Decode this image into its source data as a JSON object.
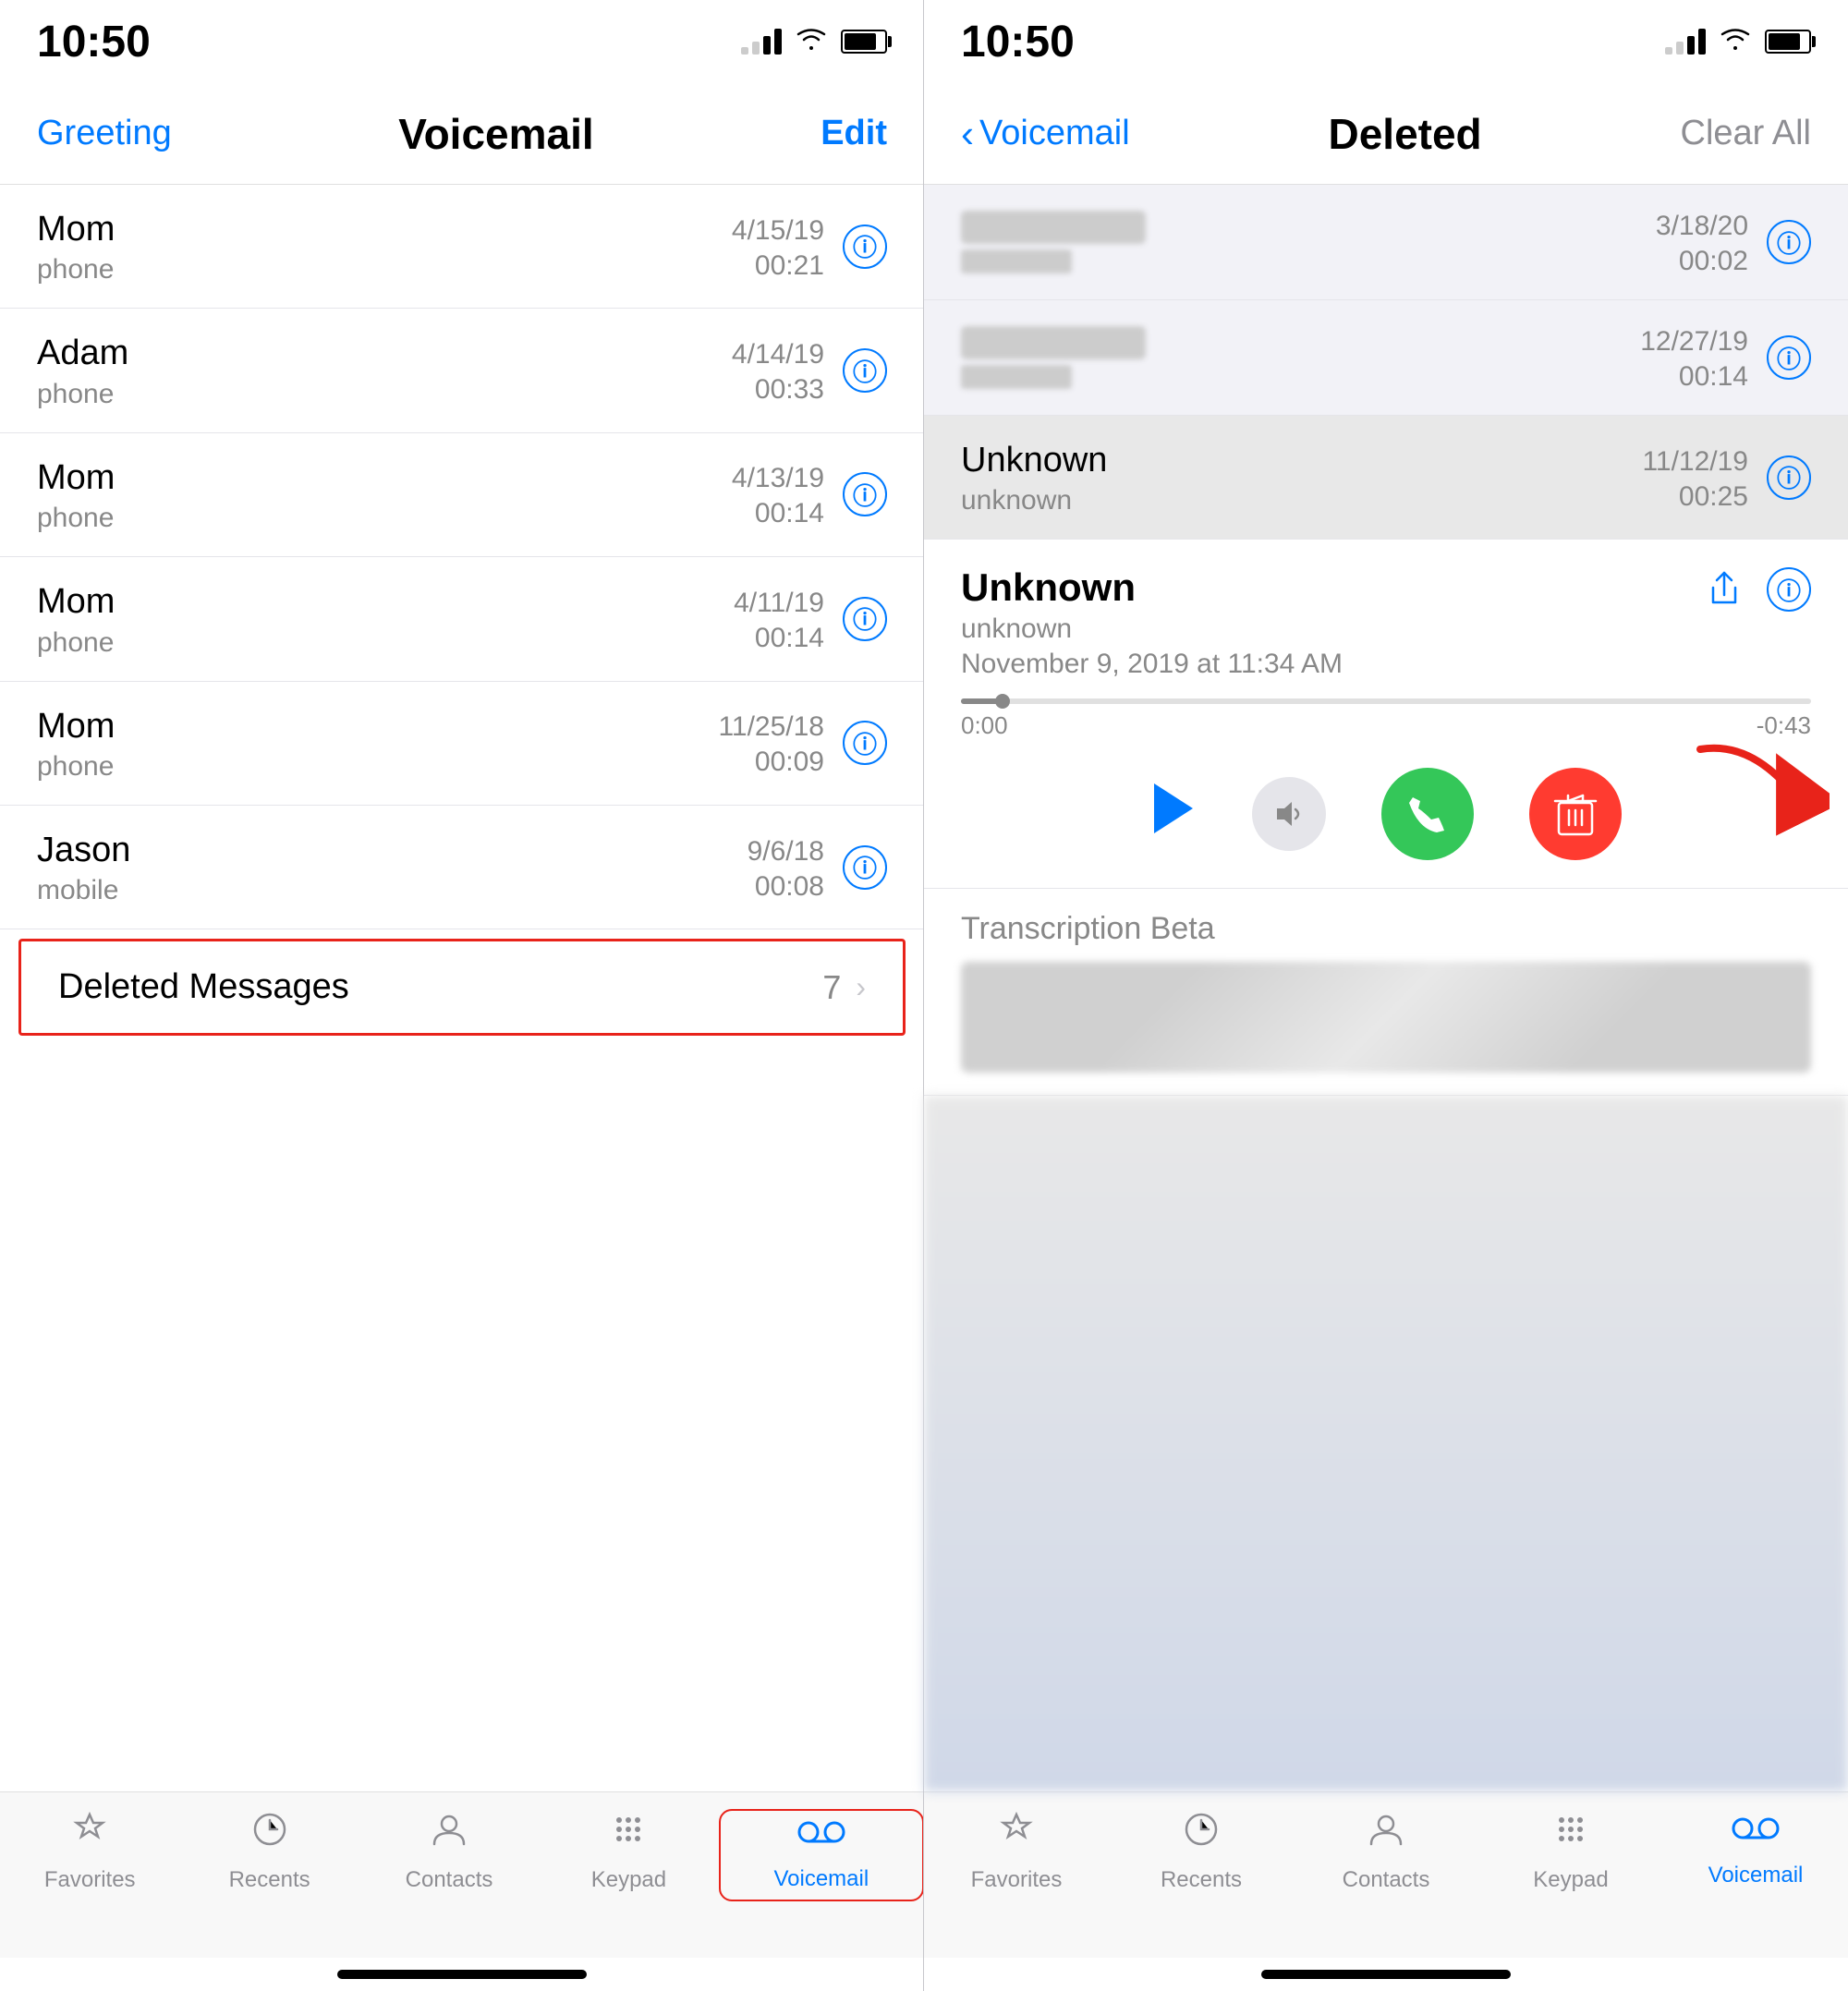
{
  "left": {
    "statusBar": {
      "time": "10:50"
    },
    "navBar": {
      "greetingLabel": "Greeting",
      "title": "Voicemail",
      "editLabel": "Edit"
    },
    "voicemails": [
      {
        "name": "Mom",
        "type": "phone",
        "date": "4/15/19",
        "duration": "00:21"
      },
      {
        "name": "Adam",
        "type": "phone",
        "date": "4/14/19",
        "duration": "00:33"
      },
      {
        "name": "Mom",
        "type": "phone",
        "date": "4/13/19",
        "duration": "00:14"
      },
      {
        "name": "Mom",
        "type": "phone",
        "date": "4/11/19",
        "duration": "00:14"
      },
      {
        "name": "Mom",
        "type": "phone",
        "date": "11/25/18",
        "duration": "00:09"
      },
      {
        "name": "Jason",
        "type": "mobile",
        "date": "9/6/18",
        "duration": "00:08"
      }
    ],
    "deletedMessages": {
      "label": "Deleted Messages",
      "count": "7"
    },
    "tabBar": {
      "items": [
        {
          "id": "favorites",
          "label": "Favorites",
          "icon": "★"
        },
        {
          "id": "recents",
          "label": "Recents",
          "icon": "⏱"
        },
        {
          "id": "contacts",
          "label": "Contacts",
          "icon": "👤"
        },
        {
          "id": "keypad",
          "label": "Keypad",
          "icon": "⠿"
        },
        {
          "id": "voicemail",
          "label": "Voicemail",
          "icon": "oo",
          "active": true
        }
      ]
    }
  },
  "right": {
    "statusBar": {
      "time": "10:50"
    },
    "navBar": {
      "backLabel": "Voicemail",
      "title": "Deleted",
      "clearAllLabel": "Clear All"
    },
    "deletedItems": [
      {
        "date": "3/18/20",
        "duration": "00:02",
        "blurred": true
      },
      {
        "date": "12/27/19",
        "duration": "00:14",
        "blurred": true
      },
      {
        "name": "Unknown",
        "type": "unknown",
        "date": "11/12/19",
        "duration": "00:25",
        "blurred": false
      }
    ],
    "expandedItem": {
      "name": "Unknown",
      "type": "unknown",
      "date": "November 9, 2019 at 11:34 AM",
      "progressStart": "0:00",
      "progressEnd": "-0:43"
    },
    "transcription": {
      "label": "Transcription Beta"
    },
    "tabBar": {
      "items": [
        {
          "id": "favorites",
          "label": "Favorites",
          "icon": "★"
        },
        {
          "id": "recents",
          "label": "Recents",
          "icon": "⏱"
        },
        {
          "id": "contacts",
          "label": "Contacts",
          "icon": "👤"
        },
        {
          "id": "keypad",
          "label": "Keypad",
          "icon": "⠿"
        },
        {
          "id": "voicemail",
          "label": "Voicemail",
          "icon": "oo",
          "active": true
        }
      ]
    }
  }
}
